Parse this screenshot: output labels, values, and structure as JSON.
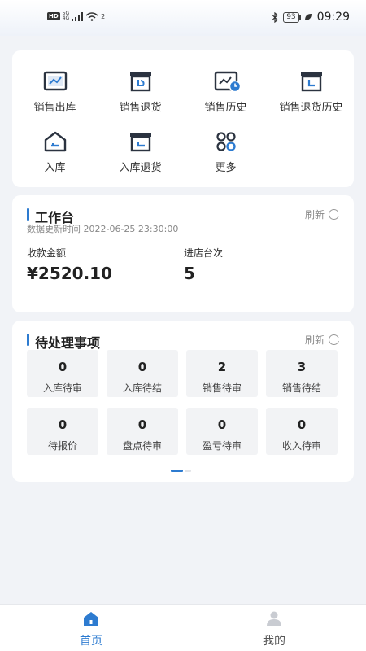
{
  "status_bar": {
    "hd": "HD",
    "net_top": "5G",
    "net_bottom": "4G",
    "wifi_sup": "2",
    "battery": "93",
    "time": "09:29"
  },
  "menu": {
    "items": [
      {
        "label": "销售出库",
        "icon": "sales-out-icon"
      },
      {
        "label": "销售退货",
        "icon": "sales-return-icon"
      },
      {
        "label": "销售历史",
        "icon": "sales-history-icon"
      },
      {
        "label": "销售退货历史",
        "icon": "sales-return-history-icon"
      },
      {
        "label": "入库",
        "icon": "stock-in-icon"
      },
      {
        "label": "入库退货",
        "icon": "stock-in-return-icon"
      },
      {
        "label": "更多",
        "icon": "more-icon"
      }
    ]
  },
  "workbench": {
    "title": "工作台",
    "refresh": "刷新",
    "update_time": "数据更新时间 2022-06-25 23:30:00",
    "stats": [
      {
        "label": "收款金额",
        "value": "¥2520.10"
      },
      {
        "label": "进店台次",
        "value": "5"
      }
    ]
  },
  "todo": {
    "title": "待处理事项",
    "refresh": "刷新",
    "items": [
      {
        "count": "0",
        "label": "入库待审"
      },
      {
        "count": "0",
        "label": "入库待结"
      },
      {
        "count": "2",
        "label": "销售待审"
      },
      {
        "count": "3",
        "label": "销售待结"
      },
      {
        "count": "0",
        "label": "待报价"
      },
      {
        "count": "0",
        "label": "盘点待审"
      },
      {
        "count": "0",
        "label": "盈亏待审"
      },
      {
        "count": "0",
        "label": "收入待审"
      }
    ]
  },
  "tabbar": {
    "home": "首页",
    "mine": "我的"
  },
  "colors": {
    "accent": "#2d7bd0",
    "icon_dark": "#2b3340",
    "background": "#f1f3f7"
  }
}
